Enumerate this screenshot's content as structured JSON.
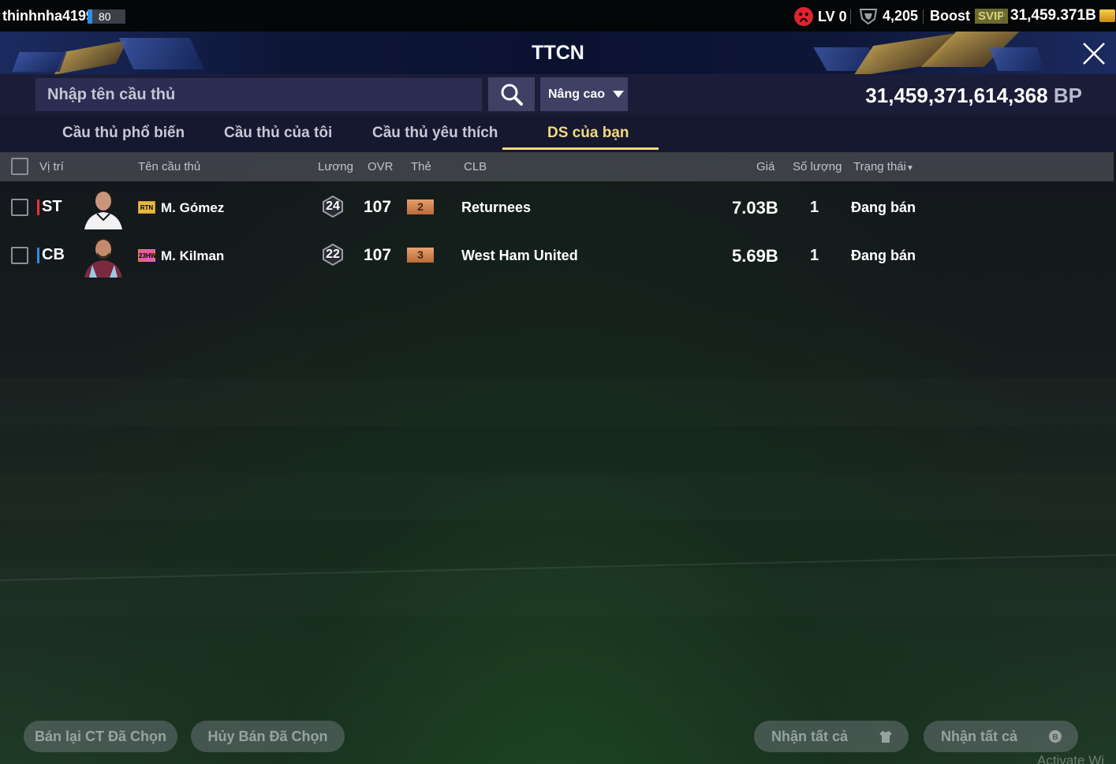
{
  "topbar": {
    "username": "thinhnha4199",
    "user_level": "80",
    "lv_label": "LV 0",
    "shield_count": "4,205",
    "boost_label": "Boost",
    "svip_label": "SVIP",
    "bp_short": "31,459.371B"
  },
  "title": "TTCN",
  "search": {
    "placeholder": "Nhập tên cầu thủ",
    "advanced_label": "Nâng cao"
  },
  "balance": {
    "amount": "31,459,371,614,368",
    "unit": "BP"
  },
  "tabs": [
    {
      "label": "Cầu thủ phổ biến",
      "active": false
    },
    {
      "label": "Cầu thủ của tôi",
      "active": false
    },
    {
      "label": "Cầu thủ yêu thích",
      "active": false
    },
    {
      "label": "DS của bạn",
      "active": true
    }
  ],
  "columns": {
    "position": "Vị trí",
    "player_name": "Tên cầu thủ",
    "salary": "Lương",
    "ovr": "OVR",
    "card": "Thẻ",
    "club": "CLB",
    "price": "Giá",
    "quantity": "Số lượng",
    "status": "Trạng thái"
  },
  "rows": [
    {
      "position": "ST",
      "position_color": "#e8323c",
      "season": "RTN",
      "name": "M. Gómez",
      "salary": "24",
      "ovr": "107",
      "card_grade": "2",
      "club": "Returnees",
      "price": "7.03B",
      "quantity": "1",
      "status": "Đang bán"
    },
    {
      "position": "CB",
      "position_color": "#2e8be6",
      "season": "23HW",
      "name": "M. Kilman",
      "salary": "22",
      "ovr": "107",
      "card_grade": "3",
      "club": "West Ham United",
      "price": "5.69B",
      "quantity": "1",
      "status": "Đang bán"
    }
  ],
  "bottom_buttons": {
    "resell_selected": "Bán lại CT Đã Chọn",
    "cancel_selected": "Hủy Bán Đã Chọn",
    "claim_all_players": "Nhận tất cả",
    "claim_all_bp": "Nhận tất cả"
  },
  "watermark": "Activate Wi"
}
